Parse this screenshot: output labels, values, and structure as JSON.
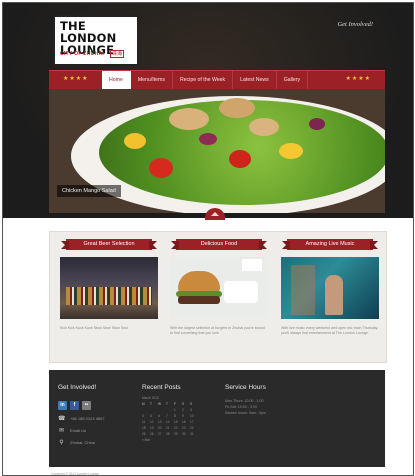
{
  "header": {
    "logo_title_line1": "THE LONDON",
    "logo_title_line2": "LOUNGE",
    "logo_subtitle": "CITY OF ZHUHAI",
    "logo_subtitle_cn": "珠海",
    "get_involved_link": "Get Involved!"
  },
  "nav": {
    "stars": "★★★★",
    "items": [
      "Home",
      "Menu/Items",
      "Recipe of the Week",
      "Latest News",
      "Gallery"
    ]
  },
  "hero": {
    "caption": "Chicken Mango Salad"
  },
  "features": [
    {
      "title": "Great Beer Selection",
      "text": "Kick Kick Kuck Kove Stow Stow Stow Soul"
    },
    {
      "title": "Delicious Food",
      "text": "With the largest selection of burgers in Zhuhai you're bound to find something that you love."
    },
    {
      "title": "Amazing Live Music",
      "text": "With live music every weekend and open mic each Thursday, you'll always find entertainment at The London Lounge."
    }
  ],
  "footer": {
    "get_involved_title": "Get Involved!",
    "recent_posts_title": "Recent Posts",
    "service_hours_title": "Service Hours",
    "phone": "+86 185 0123 4567",
    "email": "Email Us",
    "location": "Zhuhai, China",
    "calendar_month": "March 2013",
    "calendar_days": [
      "M",
      "T",
      "W",
      "T",
      "F",
      "S",
      "S"
    ],
    "calendar_dates": [
      "",
      "",
      "",
      "",
      "1",
      "2",
      "3",
      "4",
      "5",
      "6",
      "7",
      "8",
      "9",
      "10",
      "11",
      "12",
      "13",
      "14",
      "15",
      "16",
      "17",
      "18",
      "19",
      "20",
      "21",
      "22",
      "23",
      "24",
      "25",
      "26",
      "27",
      "28",
      "29",
      "30",
      "31"
    ],
    "calendar_prev": "« Mar",
    "hours_line1": "Mon-Thurs: 10:00 - 1:00",
    "hours_line2": "Fri-Sat: 10:00 - 3:00",
    "hours_line3": "Kitchen hours: 9am - 9pm"
  },
  "copyright": "Copyright © 2013 London Lounge",
  "colors": {
    "brand_red": "#9c2127",
    "star_gold": "#f0c040",
    "footer_bg": "#2a2a2a",
    "page_bg": "#ffffff"
  },
  "icons": {
    "social": [
      "linkedin-icon",
      "facebook-icon",
      "flickr-icon"
    ],
    "contact": [
      "phone-icon",
      "mail-icon",
      "location-pin-icon"
    ]
  }
}
